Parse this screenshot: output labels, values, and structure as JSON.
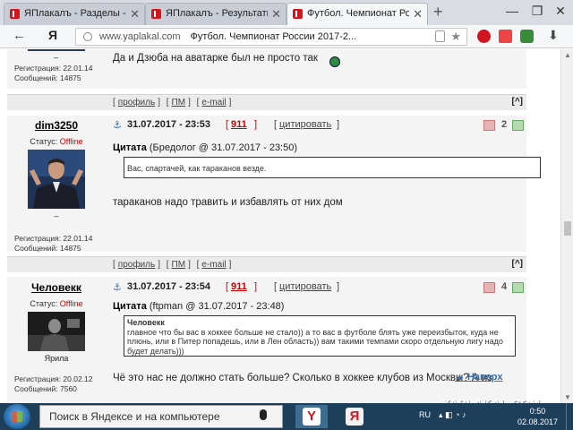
{
  "browser": {
    "tabs": [
      {
        "title": "ЯПлакалъ - Разделы -> Ци"
      },
      {
        "title": "ЯПлакалъ - Результаты пои"
      },
      {
        "title": "Футбол. Чемпионат Росси"
      }
    ],
    "new_tab": "+",
    "window_controls": {
      "minimize": "—",
      "maximize": "❐",
      "close": "✕"
    },
    "yandex_button": "Я",
    "address": {
      "domain": "www.yaplakal.com",
      "page_title": "Футбол. Чемпионат России 2017-2..."
    }
  },
  "post_top": {
    "mood": "–",
    "registered": "Регистрация: 22.01.14",
    "messages": "Сообщений: 14875",
    "text": "Да и Дзюба на аватарке был не просто так"
  },
  "footer_links": {
    "profile": "профиль",
    "pm": "ПМ",
    "email": "e-mail",
    "up": "[^]"
  },
  "posts": [
    {
      "nick": "dim3250",
      "status_label": "Статус:",
      "status_value": "Offline",
      "mood": "–",
      "registered": "Регистрация: 22.01.14",
      "messages": "Сообщений: 14875",
      "anchor": "⚓",
      "date": "31.07.2017 - 23:53",
      "number": "911",
      "cite": "цитировать",
      "votes": "2",
      "quote_label": "Цитата",
      "quote_source": "(Бредолог @ 31.07.2017 - 23:50)",
      "quote_text": "Вас, спартачей, как тараканов везде.",
      "text": "тараканов надо травить и избавлять от них дом"
    },
    {
      "nick": "Человекк",
      "status_label": "Статус:",
      "status_value": "Offline",
      "mood": "Ярила",
      "registered": "Регистрация: 20.02.12",
      "messages": "Сообщений: 7560",
      "anchor": "⚓",
      "date": "31.07.2017 - 23:54",
      "number": "911",
      "cite": "цитировать",
      "votes": "4",
      "quote_label": "Цитата",
      "quote_source": "(ftpman @ 31.07.2017 - 23:48)",
      "inner_quote_author": "Человекк",
      "quote_text": "главное что бы вас в хоккее больше не стало)) а то вас в футболе блять уже переизбыток, куда не плюнь, или в Питер попадешь, или в Лен область)) вам такими темпами скоро отдельную лигу надо будет делать)))",
      "text": "Чё это нас не должно стать больше? Сколько в хоккее клубов из Москвы? А из"
    }
  ],
  "back_to_top": "Наверх",
  "site_logo": "YAPLAKAL.COM",
  "taskbar": {
    "search_placeholder": "Поиск в Яндексе и на компьютере",
    "app_y1": "Y",
    "app_y2": "Я",
    "lang": "RU",
    "time": "0:50",
    "date": "02.08.2017"
  },
  "colors": {
    "accent_red": "#d2151f",
    "link_blue": "#3a6fb0",
    "footer_grey": "#ebebeb",
    "taskbar": "#1d3f5a"
  }
}
